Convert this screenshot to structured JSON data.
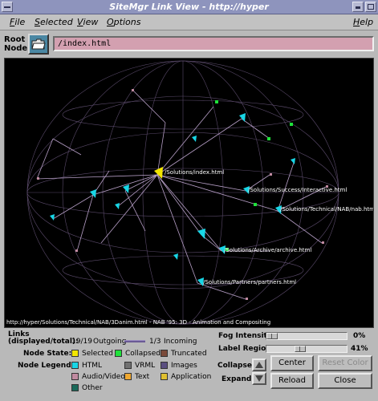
{
  "window": {
    "title": "SiteMgr Link View - http://hyper"
  },
  "menu": {
    "file": "File",
    "selected": "Selected",
    "view": "View",
    "options": "Options",
    "help": "Help"
  },
  "root": {
    "label_line1": "Root",
    "label_line2": "Node:",
    "value": "/index.html"
  },
  "graph": {
    "labels": {
      "index": "/Solutions/index.html",
      "success": "/Solutions/Success/Interactive.html",
      "nab": "/Solutions/Technical/NAB/nab.html",
      "archive": "/Solutions/Archive/archive.html",
      "partners": "/Solutions/Partners/partners.html"
    },
    "status": "http://hyper/Solutions/Technical/NAB/3Danim.html - NAB '95: 3D - Animation and Compositing"
  },
  "links": {
    "label_line1": "Links",
    "label_line2": "(displayed/total):",
    "outgoing_value": "19/19",
    "outgoing_label": "Outgoing",
    "incoming_value": "1/3",
    "incoming_label": "Incoming"
  },
  "node_state": {
    "label": "Node State:",
    "items": [
      {
        "name": "Selected",
        "color": "#f2e600"
      },
      {
        "name": "Collapsed",
        "color": "#1ee13a"
      },
      {
        "name": "Truncated",
        "color": "#7a4a3a"
      }
    ]
  },
  "node_legend": {
    "label": "Node Legend:",
    "items": [
      {
        "name": "HTML",
        "color": "#18d6e6"
      },
      {
        "name": "VRML",
        "color": "#707070"
      },
      {
        "name": "Images",
        "color": "#5a4e80"
      },
      {
        "name": "Audio/Video",
        "color": "#c08aa0"
      },
      {
        "name": "Text",
        "color": "#f0a830"
      },
      {
        "name": "Application",
        "color": "#e0c030"
      },
      {
        "name": "Other",
        "color": "#1a6a5a"
      }
    ]
  },
  "controls": {
    "fog_label": "Fog Intensity:",
    "fog_value": "0%",
    "fog_fraction": 0.0,
    "label_region_label": "Label Region:",
    "label_region_value": "41%",
    "label_region_fraction": 0.41,
    "collapse_label": "Collapse:",
    "expand_label": "Expand:",
    "center_button": "Center",
    "reset_color_button": "Reset Color",
    "reload_button": "Reload",
    "close_button": "Close"
  }
}
